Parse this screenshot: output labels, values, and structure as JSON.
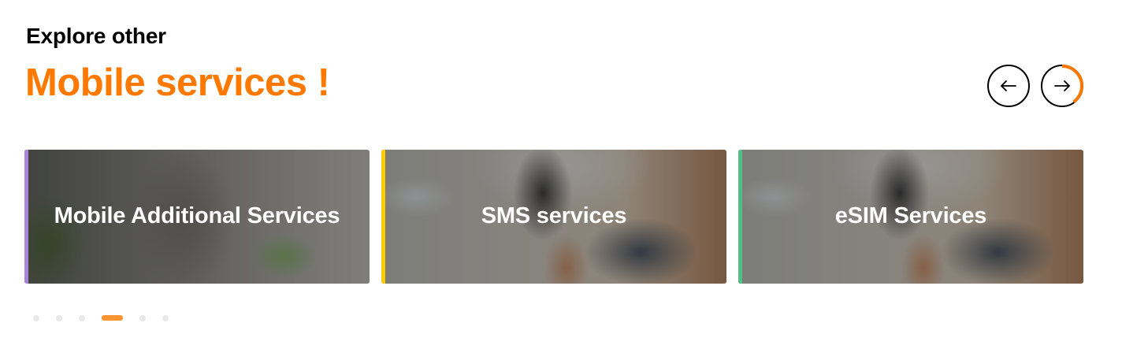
{
  "section": {
    "subheading": "Explore other",
    "heading": "Mobile services !"
  },
  "carousel": {
    "prev_icon": "arrow-left-icon",
    "next_icon": "arrow-right-icon",
    "autoplay_progress": 0.4,
    "cards": [
      {
        "label": "Mobile Additional Services",
        "accent_color": "#a885d8",
        "image": "person-holding-phone-photo"
      },
      {
        "label": "SMS services",
        "accent_color": "#ffcc00",
        "image": "hands-holding-phone-photo"
      },
      {
        "label": "eSIM Services",
        "accent_color": "#50be87",
        "image": "hands-holding-phone-photo"
      }
    ],
    "pagination": {
      "count": 6,
      "active_index": 3
    }
  },
  "colors": {
    "brand": "#ff7900",
    "text": "#000000",
    "dot_inactive": "#e8e8e8"
  }
}
